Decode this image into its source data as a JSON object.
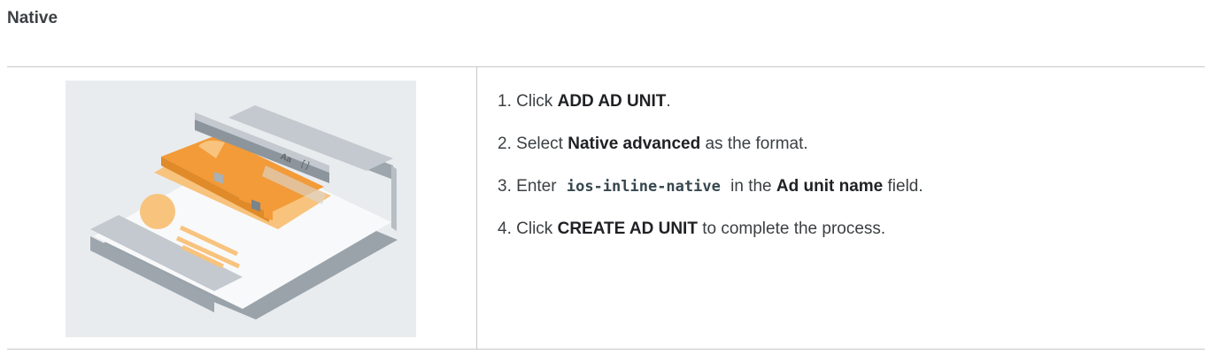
{
  "section": {
    "title": "Native"
  },
  "illustration": {
    "font_glyph": "Aa",
    "colors": {
      "orange": "#f29b38",
      "light_orange": "#f8c37d",
      "gray": "#a9b0b6",
      "dark_gray": "#7a848c"
    }
  },
  "steps": [
    {
      "number": "1.",
      "pre": "Click ",
      "bold": "ADD AD UNIT",
      "post": "."
    },
    {
      "number": "2.",
      "pre": "Select ",
      "bold": "Native advanced",
      "post": " as the format."
    },
    {
      "number": "3.",
      "pre": "Enter ",
      "code": "ios-inline-native",
      "mid": " in the ",
      "bold": "Ad unit name",
      "post": " field."
    },
    {
      "number": "4.",
      "pre": "Click ",
      "bold": "CREATE AD UNIT",
      "post": " to complete the process."
    }
  ]
}
